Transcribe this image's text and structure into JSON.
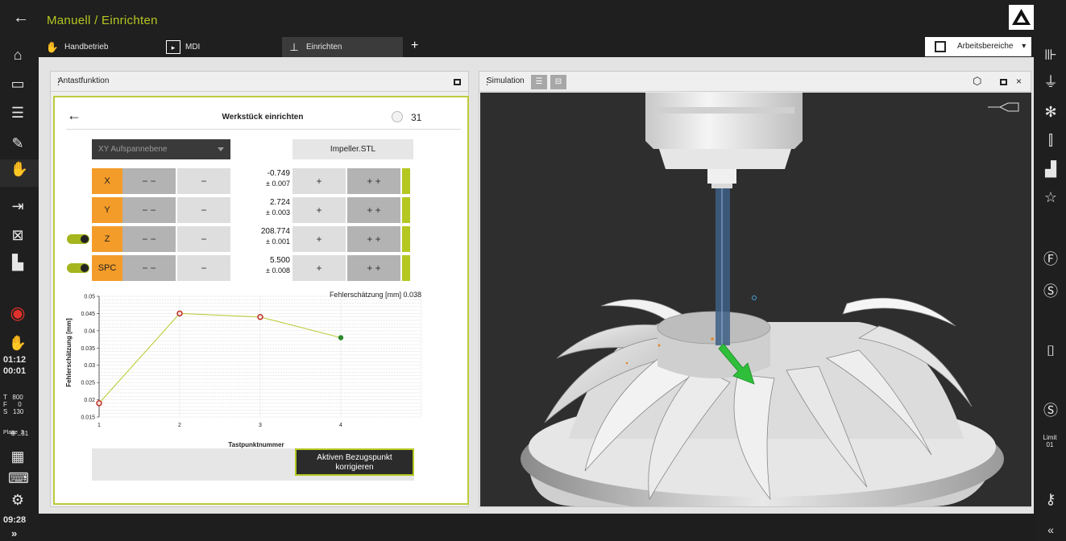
{
  "titlebar": {
    "back_icon": "back-arrow-icon",
    "title": "Manuell / Einrichten",
    "logo": "heidenhain-logo"
  },
  "tabs": [
    {
      "label": "Handbetrieb",
      "icon": "hand-icon"
    },
    {
      "label": "MDI",
      "icon": "mdi-icon"
    },
    {
      "label": "Einrichten",
      "icon": "setup-probe-icon"
    }
  ],
  "tab_add": "+",
  "workspaces": {
    "label": "Arbeitsbereiche",
    "caret": "▾"
  },
  "leftbar": {
    "time1": "01:12",
    "time2": "00:01",
    "status_lines": "T   800\nF      0\nS   130",
    "datum": "31",
    "datum_label": "Platte_2",
    "bottom_time": "09:28",
    "expand": "»"
  },
  "rightbar": {
    "limit_label": "Limit",
    "limit_value": "01",
    "collapse": "«"
  },
  "probe_panel": {
    "title": "Antastfunktion",
    "heading": "Werkstück einrichten",
    "point_number": "31",
    "plane_select": "XY Aufspannebene",
    "file_button": "Impeller.STL",
    "axes": [
      {
        "label": "X",
        "value": "-0.749",
        "tol": "± 0.007",
        "toggle": false
      },
      {
        "label": "Y",
        "value": "2.724",
        "tol": "± 0.003",
        "toggle": false
      },
      {
        "label": "Z",
        "value": "208.774",
        "tol": "± 0.001",
        "toggle": true
      },
      {
        "label": "SPC",
        "value": "5.500",
        "tol": "± 0.008",
        "toggle": true
      }
    ],
    "btn_minus_minus": "− −",
    "btn_minus": "−",
    "btn_plus": "+",
    "btn_plus_plus": "+ +",
    "correct_button_line1": "Aktiven Bezugspunkt",
    "correct_button_line2": "korrigieren"
  },
  "sim_panel": {
    "title": "Simulation"
  },
  "chart_data": {
    "type": "line",
    "title": "",
    "annotation": "Fehlerschätzung [mm] 0.038",
    "xlabel": "Tastpunktnummer",
    "ylabel": "Fehlerschätzung [mm]",
    "x": [
      1,
      2,
      3,
      4
    ],
    "values": [
      0.019,
      0.045,
      0.044,
      0.038
    ],
    "xlim": [
      1,
      5
    ],
    "ylim": [
      0.015,
      0.05
    ],
    "yticks": [
      "0.05",
      "0.045",
      "0.04",
      "0.035",
      "0.03",
      "0.025",
      "0.02",
      "0.015"
    ],
    "xticks": [
      "1",
      "2",
      "3",
      "4"
    ],
    "grid": true,
    "colors": {
      "line": "#b8c82a",
      "point_red": "#c0271f",
      "point_last": "#2b8a2b"
    }
  }
}
